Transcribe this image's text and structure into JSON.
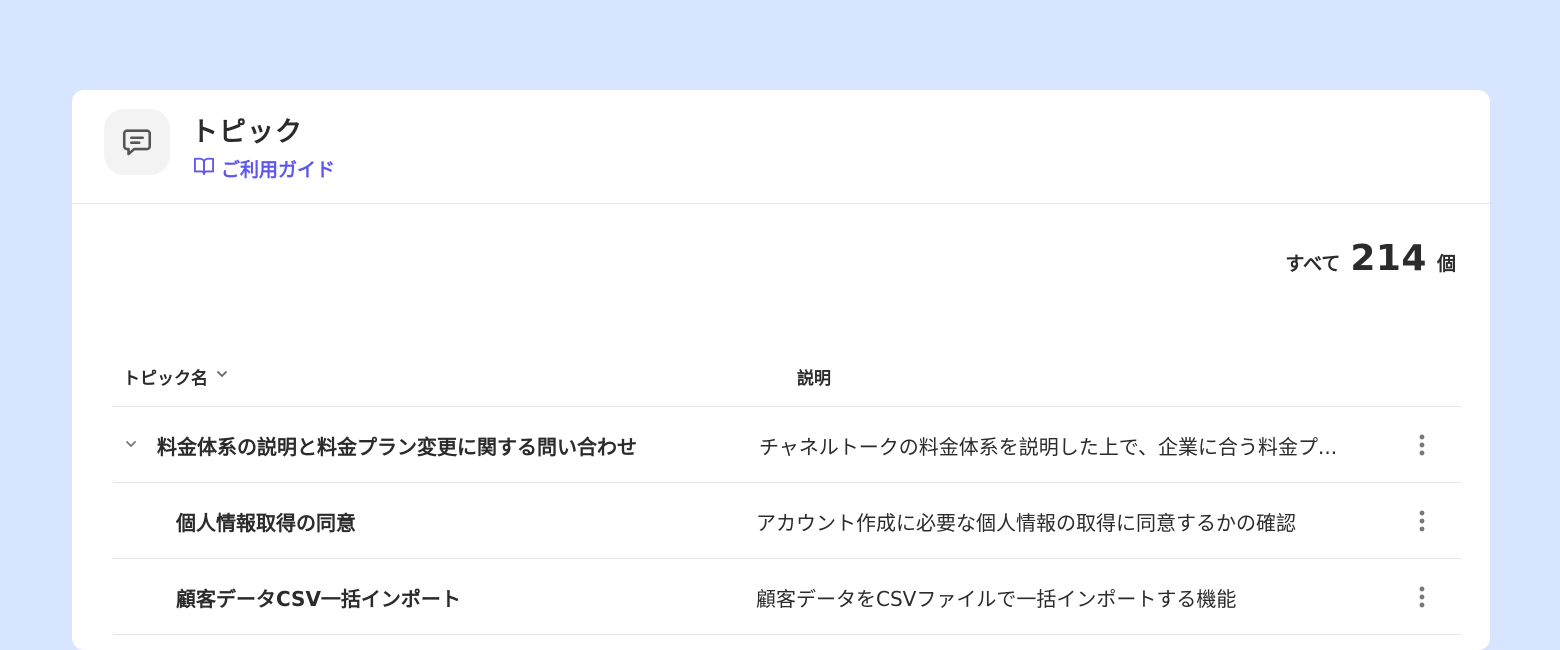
{
  "header": {
    "title": "トピック",
    "icon": "message-square-icon",
    "guide_link": "ご利用ガイド",
    "guide_icon": "book-open-icon"
  },
  "summary": {
    "label": "すべて",
    "count": "214",
    "unit": "個"
  },
  "table": {
    "columns": {
      "name": "トピック名",
      "description": "説明"
    },
    "rows": [
      {
        "name": "料金体系の説明と料金プラン変更に関する問い合わせ",
        "description": "チャネルトークの料金体系を説明した上で、企業に合う料金プ...",
        "expandable": true
      },
      {
        "name": "個人情報取得の同意",
        "description": "アカウント作成に必要な個人情報の取得に同意するかの確認",
        "expandable": false
      },
      {
        "name": "顧客データCSV一括インポート",
        "description": "顧客データをCSVファイルで一括インポートする機能",
        "expandable": false
      }
    ]
  },
  "colors": {
    "background": "#d8e5fe",
    "accent": "#5e56f0",
    "text": "#2b2b2b"
  }
}
